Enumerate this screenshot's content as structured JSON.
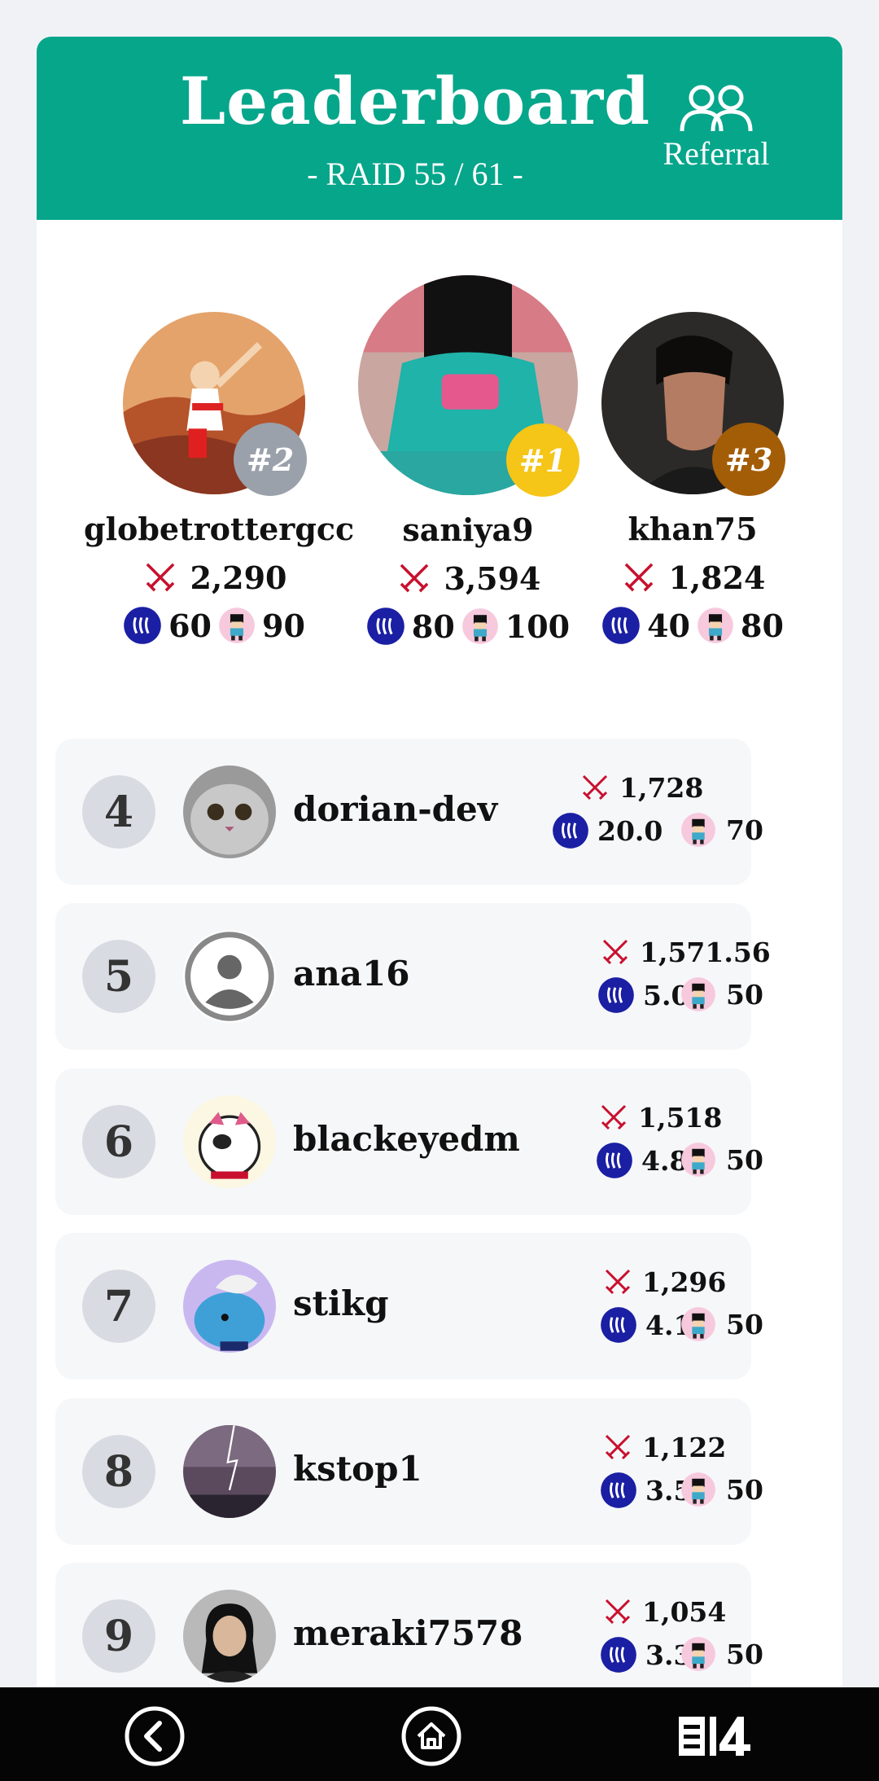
{
  "header": {
    "title": "Leaderboard",
    "subtitle": "- RAID 55 / 61 -",
    "referral_label": "Referral",
    "color": "#06a68b"
  },
  "podium": [
    {
      "rank_label": "#2",
      "name": "globetrottergcc",
      "score": "2,290",
      "steem": "60",
      "chars": "90",
      "badge_color": "#9ba1ab"
    },
    {
      "rank_label": "#1",
      "name": "saniya9",
      "score": "3,594",
      "steem": "80",
      "chars": "100",
      "badge_color": "#f5c518"
    },
    {
      "rank_label": "#3",
      "name": "khan75",
      "score": "1,824",
      "steem": "40",
      "chars": "80",
      "badge_color": "#a35d07"
    }
  ],
  "rows": [
    {
      "rank": "4",
      "name": "dorian-dev",
      "score": "1,728",
      "steem": "20.0",
      "chars": "70"
    },
    {
      "rank": "5",
      "name": "ana16",
      "score": "1,571.56",
      "steem": "5.0",
      "chars": "50"
    },
    {
      "rank": "6",
      "name": "blackeyedm",
      "score": "1,518",
      "steem": "4.8",
      "chars": "50"
    },
    {
      "rank": "7",
      "name": "stikg",
      "score": "1,296",
      "steem": "4.1",
      "chars": "50"
    },
    {
      "rank": "8",
      "name": "kstop1",
      "score": "1,122",
      "steem": "3.5",
      "chars": "50"
    },
    {
      "rank": "9",
      "name": "meraki7578",
      "score": "1,054",
      "steem": "3.3",
      "chars": "50"
    }
  ],
  "nav": {
    "back_icon": "back-arrow-icon",
    "home_icon": "home-icon",
    "menu_icon": "app-logo-icon"
  }
}
